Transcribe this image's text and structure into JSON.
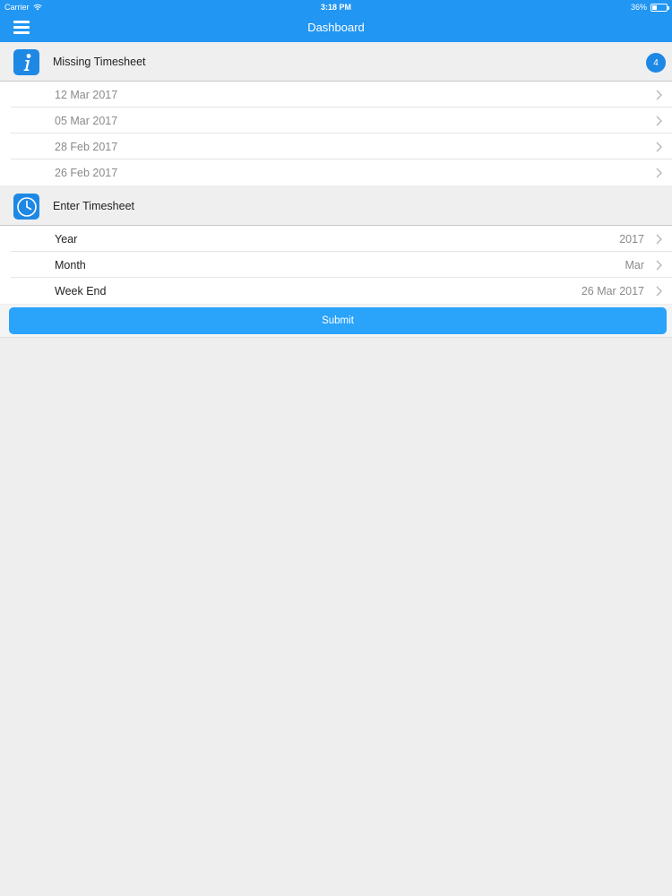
{
  "status_bar": {
    "carrier": "Carrier",
    "time": "3:18 PM",
    "battery": "36%"
  },
  "nav": {
    "title": "Dashboard"
  },
  "missing_section": {
    "title": "Missing Timesheet",
    "badge_count": "4",
    "icon": "info-icon",
    "items": [
      {
        "label": "12 Mar 2017"
      },
      {
        "label": "05 Mar 2017"
      },
      {
        "label": "28 Feb 2017"
      },
      {
        "label": "26 Feb 2017"
      }
    ]
  },
  "enter_section": {
    "title": "Enter Timesheet",
    "icon": "clock-icon",
    "fields": [
      {
        "label": "Year",
        "value": "2017"
      },
      {
        "label": "Month",
        "value": "Mar"
      },
      {
        "label": "Week End",
        "value": "26 Mar 2017"
      }
    ]
  },
  "submit_label": "Submit",
  "colors": {
    "primary": "#2196f3",
    "button": "#2aa3fb",
    "background": "#eeeeef"
  }
}
